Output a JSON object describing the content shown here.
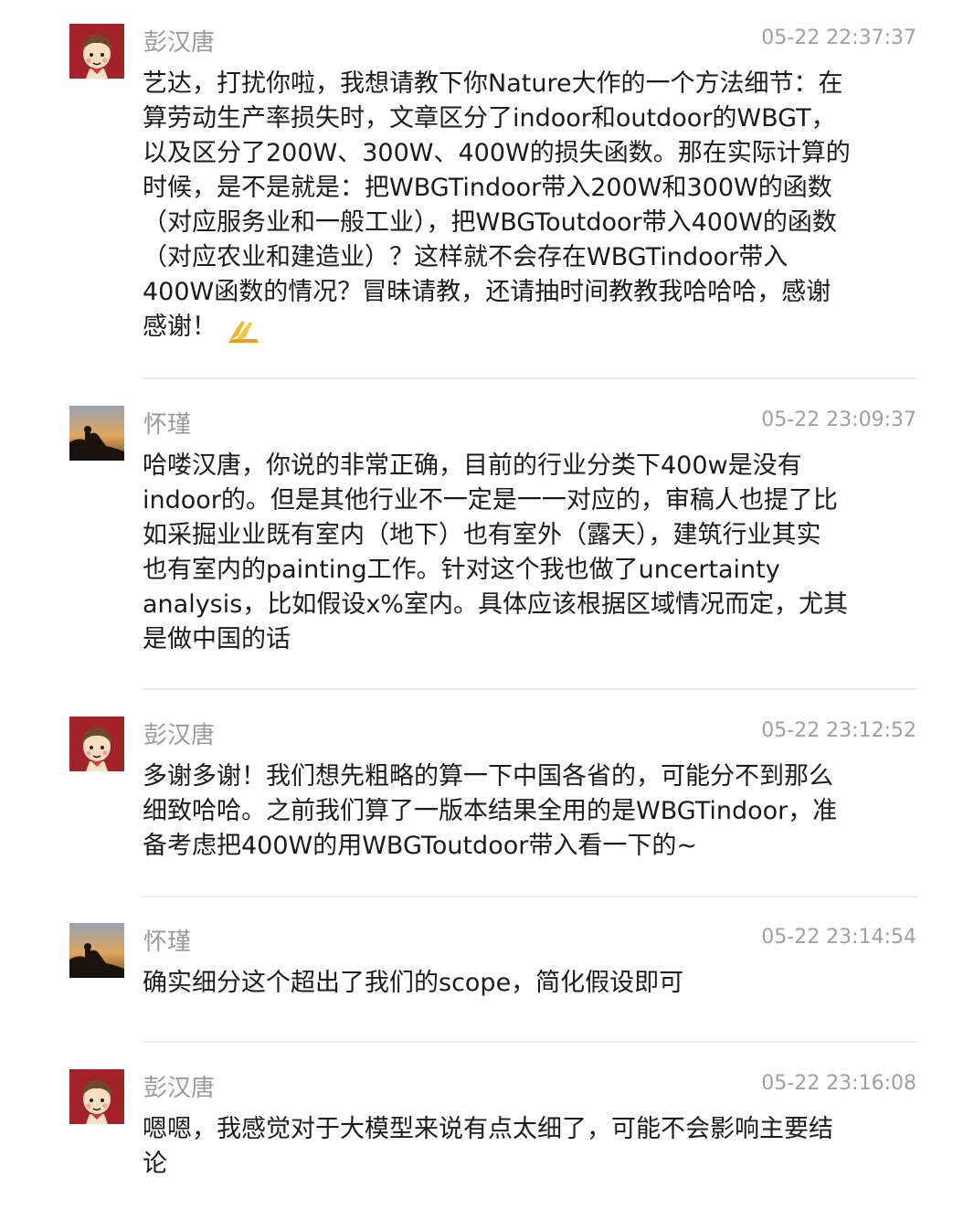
{
  "comments": [
    {
      "user": "彭汉唐",
      "time": "05-22 22:37:37",
      "lines": [
        "艺达，打扰你啦，我想请教下你Nature大作的一个方法细节：在",
        "算劳动生产率损失时，文章区分了indoor和outdoor的WBGT，",
        "以及区分了200W、300W、400W的损失函数。那在实际计算的",
        "时候，是不是就是：把WBGTindoor带入200W和300W的函数",
        "（对应服务业和一般工业），把WBGToutdoor带入400W的函数",
        "（对应农业和建造业）？这样就不会存在WBGTindoor带入",
        "400W函数的情况？冒昧请教，还请抽时间教教我哈哈哈，感谢",
        "感谢！"
      ],
      "emoji": "folded-hands"
    },
    {
      "user": "怀瑾",
      "time": "05-22 23:09:37",
      "lines": [
        "哈喽汉唐，你说的非常正确，目前的行业分类下400w是没有",
        "indoor的。但是其他行业不一定是一一对应的，审稿人也提了比",
        "如采掘业业既有室内（地下）也有室外（露天），建筑行业其实",
        "也有室内的painting工作。针对这个我也做了uncertainty",
        "analysis，比如假设x%室内。具体应该根据区域情况而定，尤其",
        "是做中国的话"
      ]
    },
    {
      "user": "彭汉唐",
      "time": "05-22 23:12:52",
      "lines": [
        "多谢多谢！我们想先粗略的算一下中国各省的，可能分不到那么",
        "细致哈哈。之前我们算了一版本结果全用的是WBGTindoor，准",
        "备考虑把400W的用WBGToutdoor带入看一下的~"
      ]
    },
    {
      "user": "怀瑾",
      "time": "05-22 23:14:54",
      "lines": [
        "确实细分这个超出了我们的scope，简化假设即可"
      ]
    },
    {
      "user": "彭汉唐",
      "time": "05-22 23:16:08",
      "lines": [
        "嗯嗯，我感觉对于大模型来说有点太细了，可能不会影响主要结",
        "论"
      ]
    }
  ]
}
